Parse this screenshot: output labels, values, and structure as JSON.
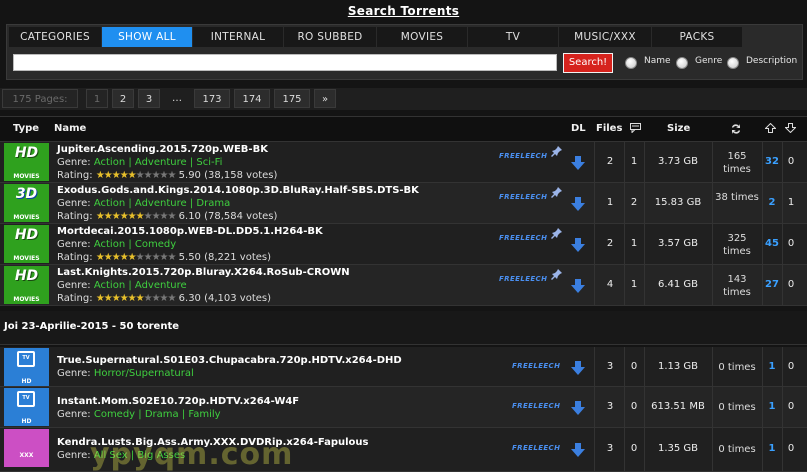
{
  "page_title": "Search Torrents",
  "tabs": [
    "CATEGORIES",
    "SHOW ALL",
    "INTERNAL",
    "RO SUBBED",
    "MOVIES",
    "TV",
    "MUSIC/XXX",
    "PACKS"
  ],
  "search": {
    "value": "",
    "button_label": "Search!",
    "options": [
      "Name",
      "Genre",
      "Description"
    ]
  },
  "pagination": {
    "label": "175 Pages:",
    "pages": [
      "1",
      "2",
      "3",
      "…",
      "173",
      "174",
      "175",
      "»"
    ]
  },
  "table_headers": {
    "type": "Type",
    "name": "Name",
    "dl": "DL",
    "files": "Files",
    "size": "Size"
  },
  "section_date": "Joi 23-Aprilie-2015 - 50 torente",
  "rating_label": "Rating:",
  "genre_label": "Genre:",
  "freeleech_label": "FREELEECH",
  "colors": {
    "accent": "#1f8ff0",
    "search_button": "#d6231d",
    "genre_link": "#3fcf3f",
    "seeders": "#3aa0ff",
    "movies_badge": "#2fa11e",
    "tv_badge": "#2b7fd6",
    "xxx_badge": "#cc4fc4"
  },
  "torrents": [
    {
      "category": "movies",
      "badge_top": "HD",
      "badge_bottom": "MOVIES",
      "name": "Jupiter.Ascending.2015.720p.WEB-BK",
      "genres": [
        "Action",
        "Adventure",
        "Sci-Fi"
      ],
      "stars": 4.5,
      "rating_text": "5.90 (38,158 votes)",
      "files": "2",
      "comments": "1",
      "size": "3.73 GB",
      "completed": "165 times",
      "seeders": "32",
      "leechers": "0"
    },
    {
      "category": "movies",
      "badge_top": "3D",
      "badge_bottom": "MOVIES",
      "name": "Exodus.Gods.and.Kings.2014.1080p.3D.BluRay.Half-SBS.DTS-BK",
      "genres": [
        "Action",
        "Adventure",
        "Drama"
      ],
      "stars": 5,
      "rating_text": "6.10 (78,584 votes)",
      "files": "1",
      "comments": "2",
      "size": "15.83 GB",
      "completed": "38 times",
      "seeders": "2",
      "leechers": "1"
    },
    {
      "category": "movies",
      "badge_top": "HD",
      "badge_bottom": "MOVIES",
      "name": "Mortdecai.2015.1080p.WEB-DL.DD5.1.H264-BK",
      "genres": [
        "Action",
        "Comedy"
      ],
      "stars": 4.5,
      "rating_text": "5.50 (8,221 votes)",
      "files": "2",
      "comments": "1",
      "size": "3.57 GB",
      "completed": "325 times",
      "seeders": "45",
      "leechers": "0"
    },
    {
      "category": "movies",
      "badge_top": "HD",
      "badge_bottom": "MOVIES",
      "name": "Last.Knights.2015.720p.Bluray.X264.RoSub-CROWN",
      "genres": [
        "Action",
        "Adventure"
      ],
      "stars": 5,
      "rating_text": "6.30 (4,103 votes)",
      "files": "4",
      "comments": "1",
      "size": "6.41 GB",
      "completed": "143 times",
      "seeders": "27",
      "leechers": "0"
    },
    {
      "category": "tv",
      "badge_top": "TV",
      "badge_bottom": "HD",
      "name": "True.Supernatural.S01E03.Chupacabra.720p.HDTV.x264-DHD",
      "genres": [
        "Horror/Supernatural"
      ],
      "files": "3",
      "comments": "0",
      "size": "1.13 GB",
      "completed": "0 times",
      "seeders": "1",
      "leechers": "0"
    },
    {
      "category": "tv",
      "badge_top": "TV",
      "badge_bottom": "HD",
      "name": "Instant.Mom.S02E10.720p.HDTV.x264-W4F",
      "genres": [
        "Comedy",
        "Drama",
        "Family"
      ],
      "files": "3",
      "comments": "0",
      "size": "613.51 MB",
      "completed": "0 times",
      "seeders": "1",
      "leechers": "0"
    },
    {
      "category": "xxx",
      "badge_top": "",
      "badge_bottom": "XXX",
      "name": "Kendra.Lusts.Big.Ass.Army.XXX.DVDRip.x264-Fapulous",
      "genres": [
        "All Sex",
        "Big Asses"
      ],
      "files": "3",
      "comments": "0",
      "size": "1.35 GB",
      "completed": "0 times",
      "seeders": "1",
      "leechers": "0"
    }
  ],
  "watermark": "ypyqm.com"
}
